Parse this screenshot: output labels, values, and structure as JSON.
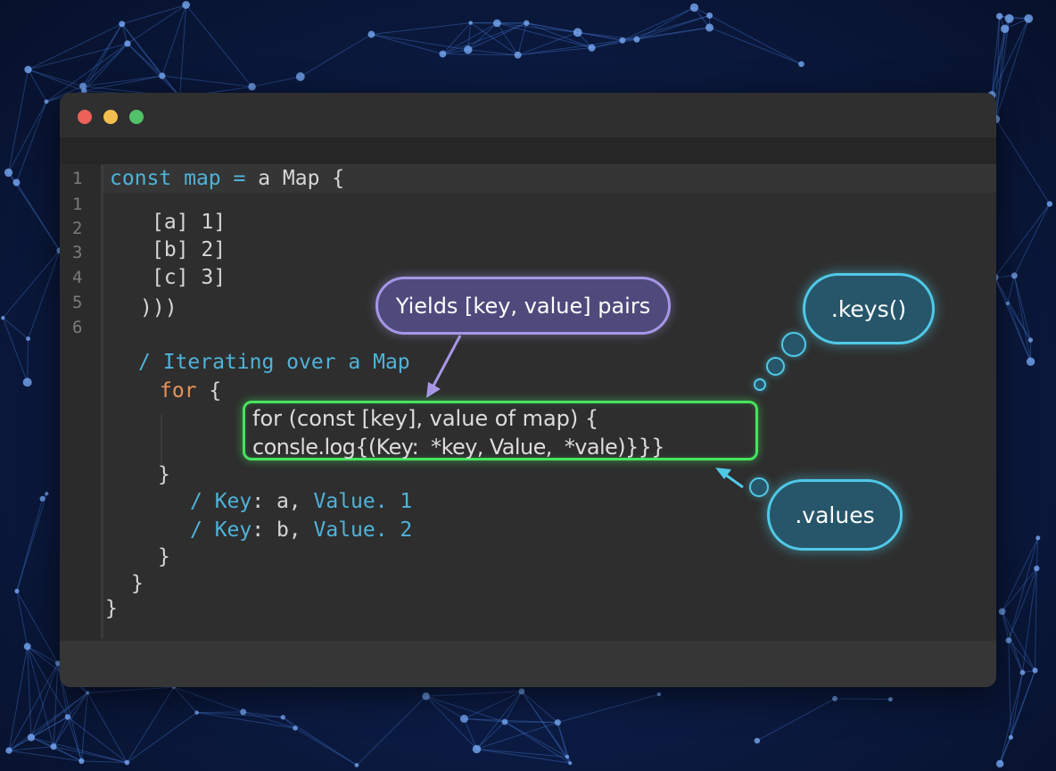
{
  "window": {
    "controls": [
      "close",
      "minimize",
      "maximize"
    ],
    "colors": {
      "close": "#ed6158",
      "minimize": "#f4bf4f",
      "maximize": "#52c168"
    }
  },
  "gutter": {
    "line_numbers": [
      "1",
      "1",
      "2",
      "3",
      "4",
      "5",
      "6"
    ]
  },
  "code": {
    "line1": {
      "kw1": "const",
      "kw2": "map",
      "eq": " =",
      "rest": " a Map {"
    },
    "entries": [
      "[a] 1]",
      "[b] 2]",
      "[c] 3]"
    ],
    "close_parens": ")))",
    "comment_iterating": "/ Iterating over a Map",
    "for_kw": "for",
    "for_brace": " {",
    "brace_close_inner": "}",
    "outputs": [
      {
        "slash": "/ ",
        "key": "Key",
        "mid": ": a, ",
        "val": "Value. 1"
      },
      {
        "slash": "/ ",
        "key": "Key",
        "mid": ": b, ",
        "val": "Value. 2"
      }
    ],
    "brace_a": "}",
    "brace_b": "}",
    "brace_c": "}"
  },
  "highlight": {
    "line1": "for (const [key], value of map) {",
    "line2": "consle.log{(Key:  *key, Value,  *vale)}}}"
  },
  "callouts": {
    "yields": "Yields [key, value] pairs",
    "keys": ".keys()",
    "values": ".values"
  },
  "colors": {
    "accent_keyword": "#4fb3d9",
    "accent_orange": "#e5935a",
    "highlight_border": "#46e35e",
    "purple_border": "#a796e6",
    "teal_border": "#4fc9e6"
  }
}
